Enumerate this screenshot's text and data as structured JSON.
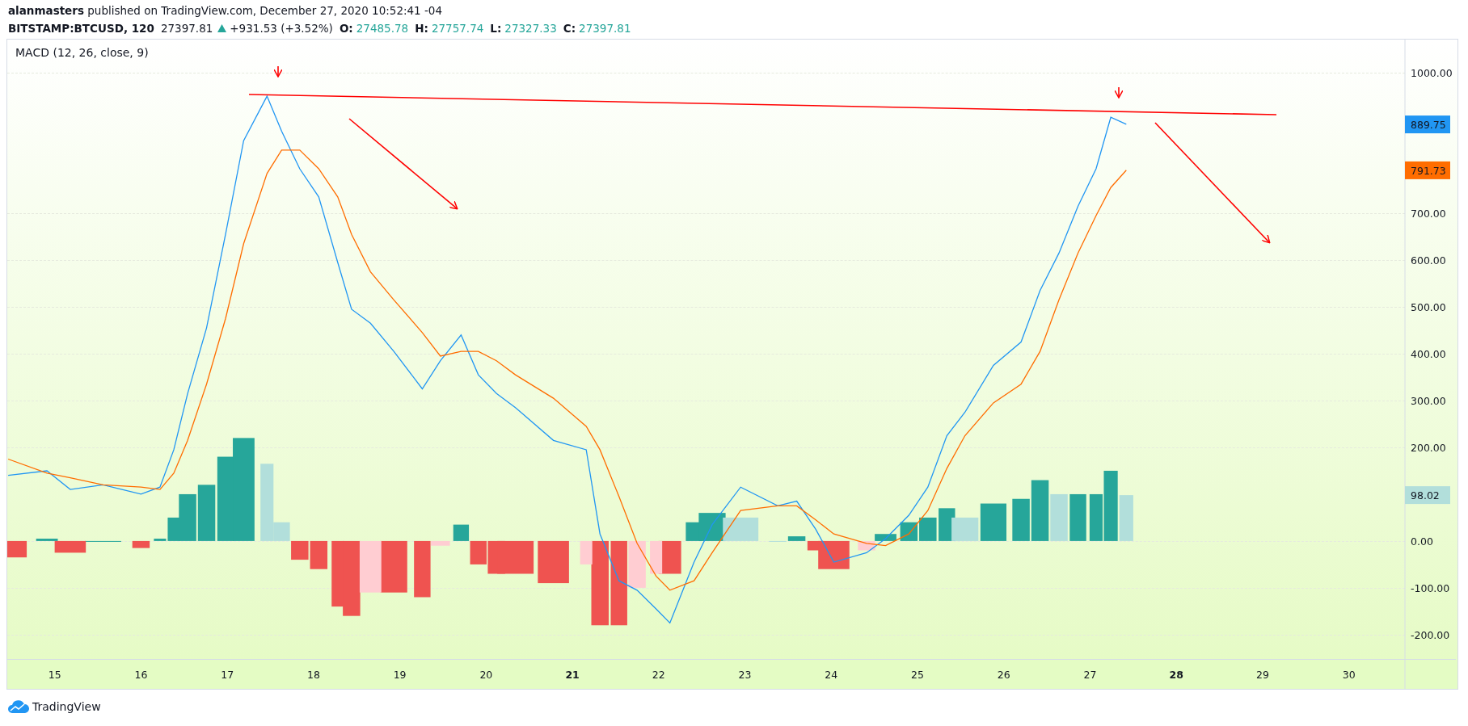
{
  "header": {
    "publication": "**alanmasters** published on TradingView.com, December 27, 2020 10:52:41 -04",
    "symbol": "BITSTAMP:BTCUSD, 120",
    "price": "27397.81",
    "rising": true,
    "change": "+931.53 (+3.52%)",
    "ohlc": [
      {
        "label": "O:",
        "value": "27485.78"
      },
      {
        "label": "H:",
        "value": "27757.74"
      },
      {
        "label": "L:",
        "value": "27327.33"
      },
      {
        "label": "C:",
        "value": "27397.81"
      }
    ]
  },
  "indicator": {
    "title": "MACD (12, 26, close, 9)",
    "chart_data": {
      "type": "line",
      "x": [
        14.46,
        14.91,
        15.18,
        15.56,
        16.0,
        16.22,
        16.38,
        16.54,
        16.76,
        16.98,
        17.19,
        17.46,
        17.63,
        17.84,
        18.06,
        18.28,
        18.44,
        18.66,
        18.93,
        19.26,
        19.47,
        19.71,
        19.91,
        20.12,
        20.34,
        20.78,
        21.16,
        21.32,
        21.54,
        21.75,
        21.97,
        22.13,
        22.41,
        22.62,
        22.95,
        23.38,
        23.6,
        23.82,
        24.03,
        24.41,
        24.63,
        24.9,
        25.12,
        25.34,
        25.55,
        25.88,
        26.2,
        26.42,
        26.64,
        26.86,
        27.07,
        27.24,
        27.42
      ],
      "series": [
        {
          "color": "#2196f3",
          "values": [
            140,
            150,
            110,
            120,
            100,
            115,
            195,
            315,
            455,
            655,
            855,
            950,
            875,
            795,
            735,
            595,
            495,
            465,
            405,
            325,
            385,
            440,
            355,
            315,
            285,
            215,
            195,
            15,
            -85,
            -105,
            -145,
            -175,
            -45,
            35,
            115,
            75,
            85,
            25,
            -45,
            -25,
            5,
            55,
            115,
            225,
            275,
            375,
            425,
            535,
            615,
            715,
            795,
            905,
            890
          ]
        },
        {
          "color": "#ff6d00",
          "values": [
            175,
            145,
            135,
            120,
            115,
            110,
            145,
            215,
            335,
            475,
            635,
            785,
            835,
            835,
            795,
            735,
            655,
            575,
            515,
            445,
            395,
            405,
            405,
            385,
            355,
            305,
            245,
            195,
            95,
            -5,
            -75,
            -105,
            -85,
            -25,
            65,
            75,
            75,
            45,
            15,
            -5,
            -10,
            15,
            65,
            155,
            225,
            295,
            335,
            405,
            515,
            615,
            695,
            755,
            792
          ]
        }
      ],
      "xlim": [
        14.45,
        31.24
      ],
      "ylim": [
        -315.8,
        1071
      ],
      "grid": true,
      "yticks": [
        {
          "value": 1000,
          "label": "1000.00"
        },
        {
          "value": 700,
          "label": "700.00"
        },
        {
          "value": 600,
          "label": "600.00"
        },
        {
          "value": 500,
          "label": "500.00"
        },
        {
          "value": 400,
          "label": "400.00"
        },
        {
          "value": 300,
          "label": "300.00"
        },
        {
          "value": 200,
          "label": "200.00"
        },
        {
          "value": 0,
          "label": "0.00"
        },
        {
          "value": -100,
          "label": "-100.00"
        },
        {
          "value": -200,
          "label": "-200.00"
        }
      ],
      "xticks": [
        {
          "value": 15,
          "label": "15"
        },
        {
          "value": 16,
          "label": "16"
        },
        {
          "value": 17,
          "label": "17"
        },
        {
          "value": 18,
          "label": "18"
        },
        {
          "value": 19,
          "label": "19"
        },
        {
          "value": 20,
          "label": "20"
        },
        {
          "value": 21,
          "label": "21"
        },
        {
          "value": 22,
          "label": "22"
        },
        {
          "value": 23,
          "label": "23"
        },
        {
          "value": 24,
          "label": "24"
        },
        {
          "value": 25,
          "label": "25"
        },
        {
          "value": 26,
          "label": "26"
        },
        {
          "value": 27,
          "label": "27"
        },
        {
          "value": 28,
          "label": "28"
        },
        {
          "value": 29,
          "label": "29"
        },
        {
          "value": 30,
          "label": "30"
        }
      ]
    },
    "xtick_bold": [
      false,
      false,
      false,
      false,
      false,
      false,
      true,
      false,
      false,
      false,
      false,
      false,
      false,
      true,
      false,
      false
    ],
    "value_labels": [
      {
        "text": "889.75",
        "color": "#2196f3"
      },
      {
        "text": "791.73",
        "color": "#ff6d00"
      },
      {
        "text": "98.02",
        "color": "#b2dfdb"
      }
    ],
    "histogram": {
      "chart_data": {
        "type": "bar",
        "x": [
          14.46,
          14.91,
          15.18,
          15.56,
          16.0,
          16.22,
          16.38,
          16.54,
          16.76,
          16.98,
          17.19,
          17.46,
          17.63,
          17.84,
          18.06,
          18.28,
          18.44,
          18.66,
          18.93,
          19.26,
          19.47,
          19.71,
          19.91,
          20.12,
          20.34,
          20.78,
          21.16,
          21.32,
          21.54,
          21.75,
          21.97,
          22.13,
          22.41,
          22.62,
          22.95,
          23.38,
          23.6,
          23.82,
          24.03,
          24.41,
          24.63,
          24.9,
          25.12,
          25.34,
          25.55,
          25.88,
          26.2,
          26.42,
          26.64,
          26.86,
          27.07,
          27.24,
          27.42
        ],
        "xlim": [
          14.45,
          31.24
        ],
        "ylim": [
          -315.8,
          1071
        ],
        "series": [
          {
            "color": "#26a69a",
            "values": [
              null,
              5,
              null,
              0,
              null,
              5,
              50,
              100,
              120,
              180,
              220,
              null,
              null,
              null,
              null,
              null,
              null,
              null,
              null,
              null,
              null,
              35,
              null,
              null,
              null,
              null,
              null,
              null,
              null,
              null,
              null,
              null,
              40,
              60,
              null,
              null,
              10,
              null,
              null,
              null,
              15,
              40,
              50,
              70,
              null,
              80,
              90,
              130,
              null,
              100,
              100,
              150,
              null
            ]
          },
          {
            "color": "#b2dfdb",
            "values": [
              null,
              null,
              null,
              null,
              null,
              null,
              null,
              null,
              null,
              null,
              null,
              165,
              40,
              null,
              null,
              null,
              null,
              null,
              null,
              null,
              null,
              null,
              null,
              null,
              null,
              null,
              null,
              null,
              null,
              null,
              null,
              null,
              null,
              null,
              50,
              0,
              null,
              null,
              null,
              null,
              null,
              null,
              null,
              null,
              50,
              null,
              null,
              null,
              100,
              null,
              null,
              null,
              98
            ]
          },
          {
            "color": "#ef5350",
            "values": [
              -35,
              null,
              -25,
              null,
              -15,
              null,
              null,
              null,
              null,
              null,
              null,
              null,
              null,
              -40,
              -60,
              -140,
              -160,
              null,
              -110,
              -120,
              null,
              null,
              -50,
              -70,
              -70,
              -90,
              null,
              -180,
              -180,
              null,
              null,
              -70,
              null,
              null,
              null,
              null,
              null,
              -20,
              -60,
              null,
              null,
              null,
              null,
              null,
              null,
              null,
              null,
              null,
              null,
              null,
              null,
              null,
              null
            ]
          },
          {
            "color": "#ffcdd2",
            "values": [
              null,
              null,
              null,
              null,
              null,
              null,
              null,
              null,
              null,
              null,
              null,
              null,
              null,
              null,
              null,
              null,
              null,
              -110,
              null,
              null,
              -10,
              null,
              null,
              null,
              null,
              null,
              -50,
              null,
              null,
              -100,
              -70,
              null,
              null,
              null,
              null,
              null,
              null,
              null,
              null,
              -20,
              null,
              null,
              null,
              null,
              null,
              null,
              null,
              null,
              null,
              null,
              null,
              null,
              null
            ]
          }
        ]
      }
    }
  },
  "footer": {
    "brand": "TradingView"
  }
}
